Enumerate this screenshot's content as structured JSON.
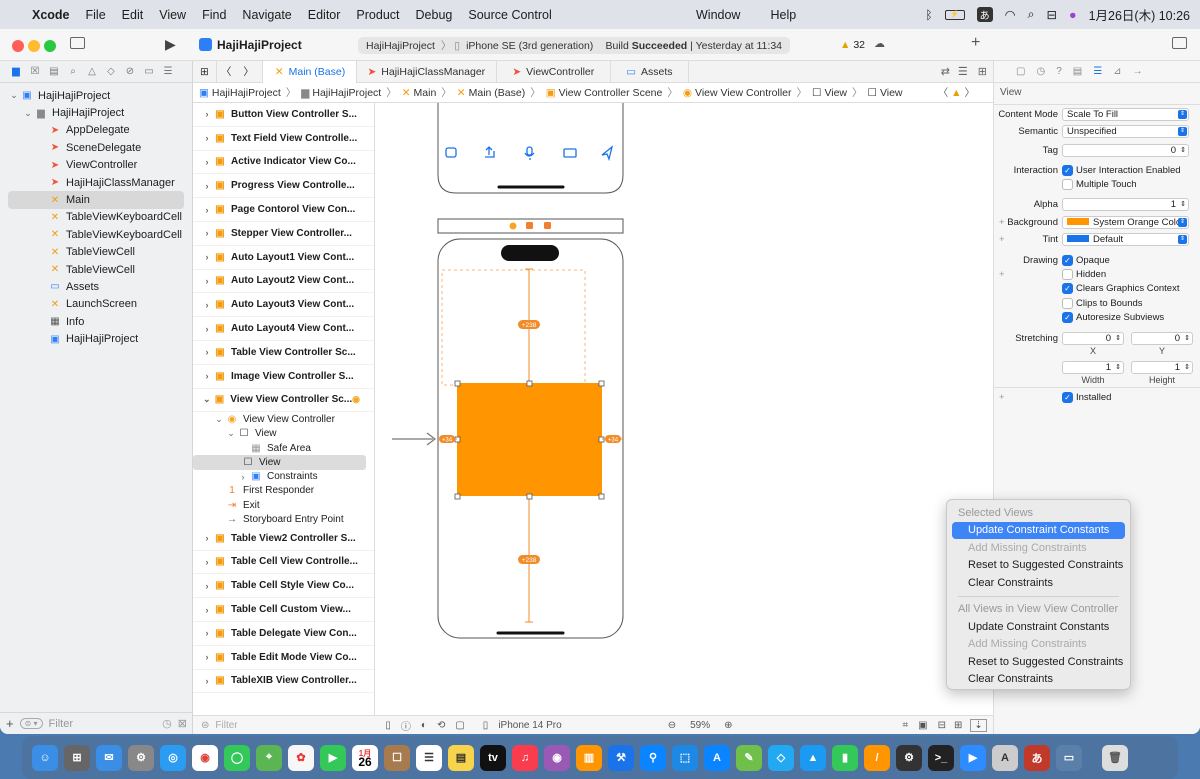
{
  "menubar": {
    "app": "Xcode",
    "items": [
      "File",
      "Edit",
      "View",
      "Find",
      "Navigate",
      "Editor",
      "Product",
      "Debug",
      "Source Control"
    ],
    "window": "Window",
    "help": "Help",
    "clock": "1月26日(木) 10:26",
    "ime": "あ"
  },
  "toolbar": {
    "project": "HajiHajiProject",
    "scheme": "HajiHajiProject",
    "device": "iPhone SE (3rd generation)",
    "status_prefix": "Build ",
    "status": "Succeeded",
    "status_time": "| Yesterday at 11:34",
    "warnings": "32"
  },
  "navigator": {
    "items": [
      {
        "label": "HajiHajiProject",
        "kind": "proj",
        "level": 0,
        "chev": "v"
      },
      {
        "label": "HajiHajiProject",
        "kind": "folder",
        "level": 1,
        "chev": "v"
      },
      {
        "label": "AppDelegate",
        "kind": "swift",
        "level": 2
      },
      {
        "label": "SceneDelegate",
        "kind": "swift",
        "level": 2
      },
      {
        "label": "ViewController",
        "kind": "swift",
        "level": 2
      },
      {
        "label": "HajiHajiClassManager",
        "kind": "swift",
        "level": 2
      },
      {
        "label": "Main",
        "kind": "xib",
        "level": 2,
        "selected": true
      },
      {
        "label": "TableViewKeyboardCell",
        "kind": "xib",
        "level": 2
      },
      {
        "label": "TableViewKeyboardCell",
        "kind": "xib",
        "level": 2
      },
      {
        "label": "TableViewCell",
        "kind": "xib",
        "level": 2
      },
      {
        "label": "TableViewCell",
        "kind": "xib",
        "level": 2
      },
      {
        "label": "Assets",
        "kind": "assets",
        "level": 2
      },
      {
        "label": "LaunchScreen",
        "kind": "xib",
        "level": 2
      },
      {
        "label": "Info",
        "kind": "table",
        "level": 2
      },
      {
        "label": "HajiHajiProject",
        "kind": "proj",
        "level": 2
      }
    ],
    "filter_placeholder": "Filter"
  },
  "tabs": [
    "Main (Base)",
    "HajiHajiClassManager",
    "ViewController",
    "Assets"
  ],
  "jumpbar": [
    "HajiHajiProject",
    "HajiHajiProject",
    "Main",
    "Main (Base)",
    "View Controller Scene",
    "View View Controller",
    "View",
    "View"
  ],
  "outline": {
    "scenes_top": [
      "Button View Controller S...",
      "Text Field View Controlle...",
      "Active Indicator View Co...",
      "Progress View Controlle...",
      "Page Contorol View Con...",
      "Stepper View Controller...",
      "Auto Layout1 View Cont...",
      "Auto Layout2 View Cont...",
      "Auto Layout3 View Cont...",
      "Auto Layout4 View Cont...",
      "Table View Controller Sc...",
      "Image View Controller S..."
    ],
    "open_scene": "View View Controller Sc...",
    "children": [
      {
        "label": "View View Controller",
        "indent": 1,
        "chev": "v"
      },
      {
        "label": "View",
        "indent": 2,
        "chev": "v"
      },
      {
        "label": "Safe Area",
        "indent": 3
      },
      {
        "label": "View",
        "indent": 3,
        "selected": true
      },
      {
        "label": "Constraints",
        "indent": 3,
        "chev": ">"
      },
      {
        "label": "First Responder",
        "indent": 1
      },
      {
        "label": "Exit",
        "indent": 1
      },
      {
        "label": "Storyboard Entry Point",
        "indent": 1
      }
    ],
    "scenes_bottom": [
      "Table View2 Controller S...",
      "Table Cell View Controlle...",
      "Table Cell Style View Co...",
      "Table Cell Custom View...",
      "Table Delegate View Con...",
      "Table Edit Mode View Co...",
      "TableXIB View Controller..."
    ]
  },
  "canvas": {
    "constraint_top": "+238",
    "constraint_bottom": "+238",
    "constraint_left": "+34",
    "constraint_right": "+34",
    "view_color": "#FF9500"
  },
  "bottombar": {
    "filter_placeholder": "Filter",
    "device": "iPhone 14 Pro",
    "zoom": "59%"
  },
  "inspector": {
    "section": "View",
    "content_mode_label": "Content Mode",
    "content_mode": "Scale To Fill",
    "semantic_label": "Semantic",
    "semantic": "Unspecified",
    "tag_label": "Tag",
    "tag": "0",
    "interaction_label": "Interaction",
    "user_interaction": "User Interaction Enabled",
    "multiple_touch": "Multiple Touch",
    "alpha_label": "Alpha",
    "alpha": "1",
    "background_label": "Background",
    "background": "System Orange Color",
    "tint_label": "Tint",
    "tint": "Default",
    "drawing_label": "Drawing",
    "opaque": "Opaque",
    "hidden": "Hidden",
    "clears": "Clears Graphics Context",
    "clips": "Clips to Bounds",
    "autoresize": "Autoresize Subviews",
    "stretching_label": "Stretching",
    "stretch_x": "0",
    "stretch_y": "0",
    "x_label": "X",
    "y_label": "Y",
    "stretch_w": "1",
    "stretch_h": "1",
    "w_label": "Width",
    "h_label": "Height",
    "installed": "Installed"
  },
  "context_menu": {
    "header1": "Selected Views",
    "items1": [
      {
        "label": "Update Constraint Constants",
        "state": "highlighted"
      },
      {
        "label": "Add Missing Constraints",
        "state": "disabled"
      },
      {
        "label": "Reset to Suggested Constraints",
        "state": "normal"
      },
      {
        "label": "Clear Constraints",
        "state": "normal"
      }
    ],
    "header2": "All Views in View View Controller",
    "items2": [
      {
        "label": "Update Constraint Constants",
        "state": "normal"
      },
      {
        "label": "Add Missing Constraints",
        "state": "disabled"
      },
      {
        "label": "Reset to Suggested Constraints",
        "state": "normal"
      },
      {
        "label": "Clear Constraints",
        "state": "normal"
      }
    ]
  },
  "dock": {
    "calendar_month": "1月",
    "calendar_day": "26",
    "tv": "tv",
    "ime": "あ"
  }
}
